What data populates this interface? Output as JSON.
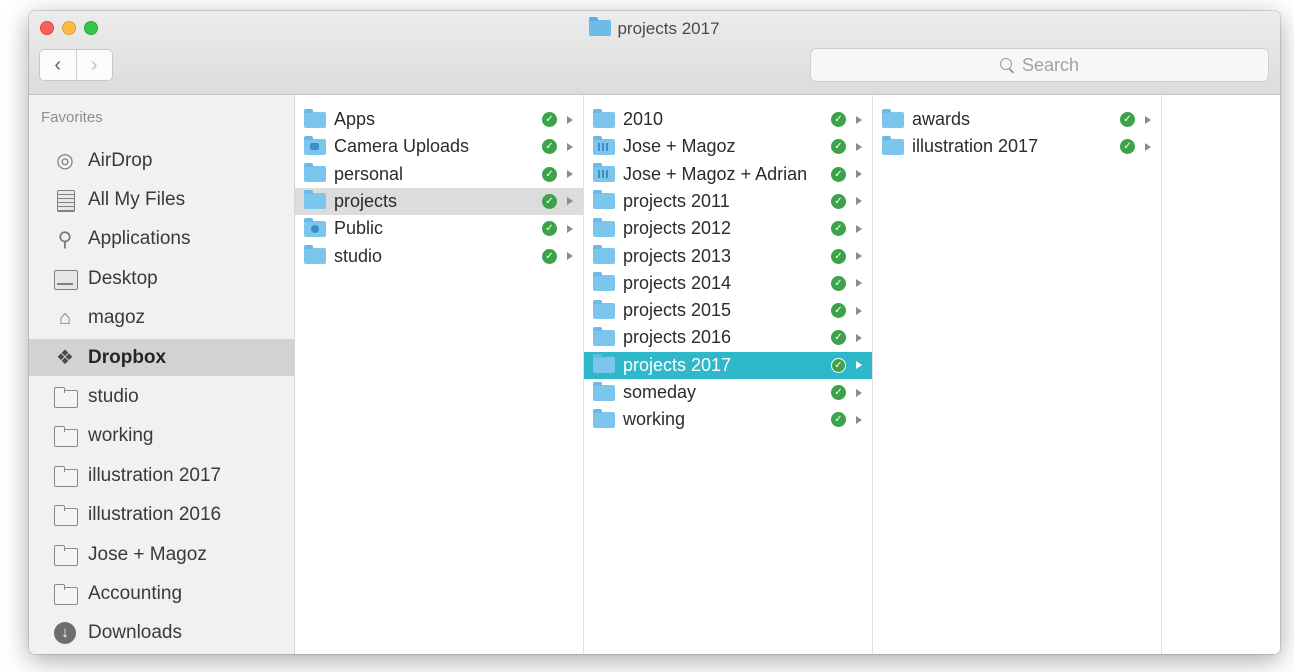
{
  "window": {
    "title": "projects 2017",
    "search_placeholder": "Search"
  },
  "nav": {
    "back": "‹",
    "forward": "›"
  },
  "sidebar": {
    "heading": "Favorites",
    "items": [
      {
        "label": "AirDrop",
        "icon": "airdrop-icon"
      },
      {
        "label": "All My Files",
        "icon": "all-files-icon"
      },
      {
        "label": "Applications",
        "icon": "applications-icon"
      },
      {
        "label": "Desktop",
        "icon": "desktop-icon"
      },
      {
        "label": "magoz",
        "icon": "home-icon"
      },
      {
        "label": "Dropbox",
        "icon": "dropbox-icon",
        "selected": true
      },
      {
        "label": "studio",
        "icon": "folder-icon"
      },
      {
        "label": "working",
        "icon": "folder-icon"
      },
      {
        "label": "illustration 2017",
        "icon": "folder-icon"
      },
      {
        "label": "illustration 2016",
        "icon": "folder-icon"
      },
      {
        "label": "Jose + Magoz",
        "icon": "folder-icon"
      },
      {
        "label": "Accounting",
        "icon": "folder-icon"
      },
      {
        "label": "Downloads",
        "icon": "downloads-icon"
      }
    ]
  },
  "columns": {
    "col1": [
      {
        "label": "Apps",
        "icon": "folder-icon"
      },
      {
        "label": "Camera Uploads",
        "icon": "camera-folder-icon"
      },
      {
        "label": "personal",
        "icon": "folder-icon"
      },
      {
        "label": "projects",
        "icon": "folder-icon",
        "selected": "inactive"
      },
      {
        "label": "Public",
        "icon": "public-folder-icon"
      },
      {
        "label": "studio",
        "icon": "folder-icon"
      }
    ],
    "col2": [
      {
        "label": "2010",
        "icon": "folder-icon"
      },
      {
        "label": "Jose + Magoz",
        "icon": "shared-folder-icon"
      },
      {
        "label": "Jose + Magoz + Adrian",
        "icon": "shared-folder-icon"
      },
      {
        "label": "projects 2011",
        "icon": "folder-icon"
      },
      {
        "label": "projects 2012",
        "icon": "folder-icon"
      },
      {
        "label": "projects 2013",
        "icon": "folder-icon"
      },
      {
        "label": "projects 2014",
        "icon": "folder-icon"
      },
      {
        "label": "projects 2015",
        "icon": "folder-icon"
      },
      {
        "label": "projects 2016",
        "icon": "folder-icon"
      },
      {
        "label": "projects 2017",
        "icon": "folder-icon",
        "selected": "active"
      },
      {
        "label": "someday",
        "icon": "folder-icon"
      },
      {
        "label": "working",
        "icon": "folder-icon"
      }
    ],
    "col3": [
      {
        "label": "awards",
        "icon": "folder-icon"
      },
      {
        "label": "illustration 2017",
        "icon": "folder-icon"
      }
    ]
  },
  "colors": {
    "selection_active": "#2fb8c9",
    "selection_inactive": "#dcdcdc",
    "sync_check": "#3da34a",
    "folder": "#7cc6ee"
  }
}
